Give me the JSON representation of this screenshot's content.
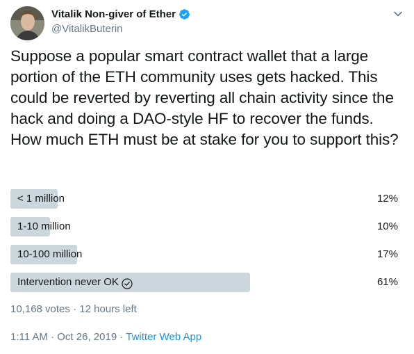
{
  "author": {
    "display_name": "Vitalik Non-giver of Ether",
    "handle": "@VitalikButerin",
    "verified": true
  },
  "tweet": {
    "text": "Suppose a popular smart contract wallet that a large portion of the ETH community uses gets hacked. This could be reverted by reverting all chain activity since the hack and doing a DAO-style HF to recover the funds. How much ETH must be at stake for you to support this?"
  },
  "poll": {
    "options": [
      {
        "label": "< 1 million",
        "percent_text": "12%",
        "percent": 12
      },
      {
        "label": "1-10 million",
        "percent_text": "10%",
        "percent": 10
      },
      {
        "label": "10-100 million",
        "percent_text": "17%",
        "percent": 17
      },
      {
        "label": "Intervention never OK",
        "percent_text": "61%",
        "percent": 61,
        "winner": true
      }
    ],
    "votes": "10,168 votes",
    "sep": "·",
    "time_left": "12 hours left"
  },
  "meta": {
    "time": "1:11 AM",
    "sep1": "·",
    "date": "Oct 26, 2019",
    "sep2": "·",
    "source": "Twitter Web App"
  },
  "colors": {
    "accent": "#1da1f2",
    "bar": "#ccd6dd",
    "muted": "#657786"
  },
  "icons": {
    "verified": "verified-badge-icon",
    "caret": "chevron-down-icon",
    "winner": "check-circle-icon"
  }
}
